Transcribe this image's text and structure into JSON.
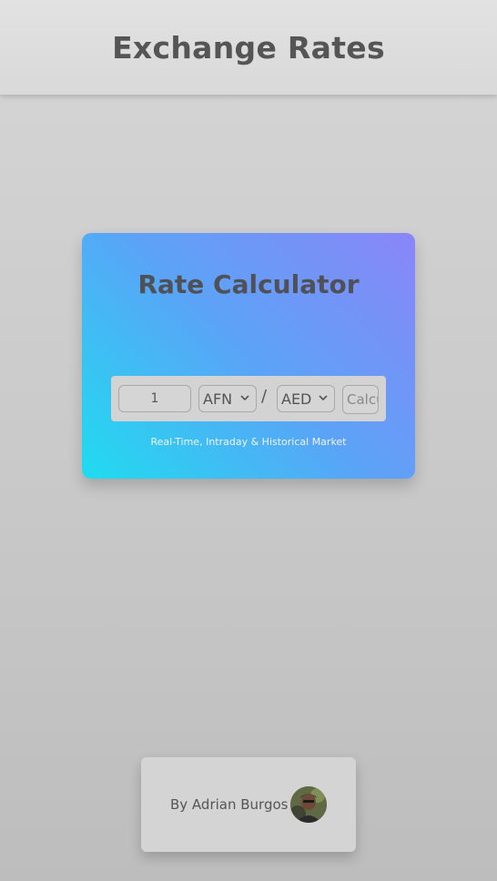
{
  "header": {
    "title": "Exchange Rates"
  },
  "calculator": {
    "title": "Rate Calculator",
    "amount_value": "1",
    "from_currency": "AFN",
    "separator": "/",
    "to_currency": "AED",
    "calculate_label": "Calculate",
    "caption": "Real-Time, Intraday & Historical Market",
    "gradient_colors": [
      "#8a86f7",
      "#5ba3f7",
      "#1fdcef"
    ]
  },
  "author": {
    "byline": "By Adrian Burgos"
  },
  "colors": {
    "title_text": "#555555",
    "background": "#cacaca"
  }
}
